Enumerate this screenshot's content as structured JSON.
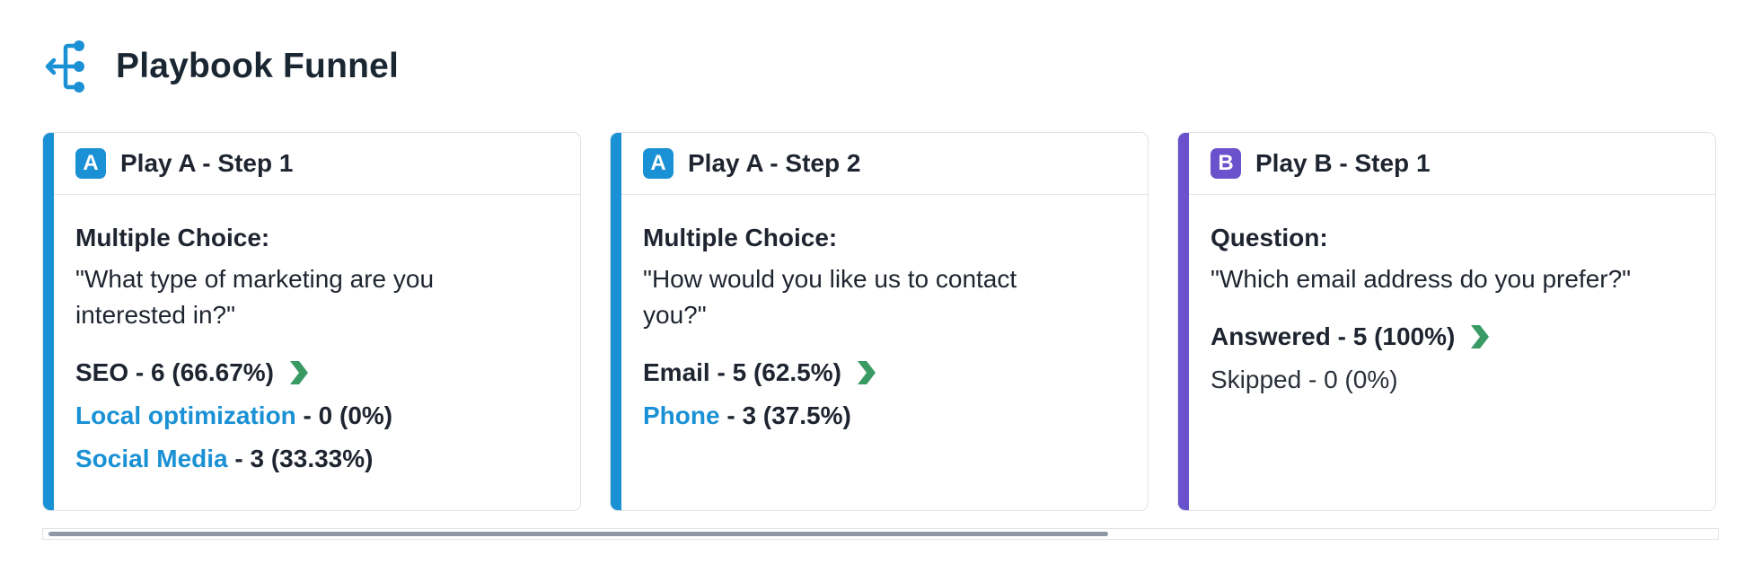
{
  "header": {
    "title": "Playbook Funnel",
    "icon": "funnel-flow-icon"
  },
  "colors": {
    "play_a": "#1a91d4",
    "play_b": "#6a52cc",
    "link": "#1a91d4",
    "arrow": "#3a9a64"
  },
  "cards": [
    {
      "badge": "A",
      "title": "Play A - Step 1",
      "question_type": "Multiple Choice:",
      "question_text": "\"What type of marketing are you interested in?\"",
      "answers": [
        {
          "option": "SEO",
          "stat": " - 6 (66.67%)",
          "link": false,
          "arrow": true
        },
        {
          "option": "Local optimization",
          "stat": " - 0 (0%)",
          "link": true,
          "arrow": false
        },
        {
          "option": "Social Media",
          "stat": " - 3 (33.33%)",
          "link": true,
          "arrow": false
        }
      ]
    },
    {
      "badge": "A",
      "title": "Play A - Step 2",
      "question_type": "Multiple Choice:",
      "question_text": "\"How would you like us to contact you?\"",
      "answers": [
        {
          "option": "Email",
          "stat": " - 5 (62.5%)",
          "link": false,
          "arrow": true
        },
        {
          "option": "Phone",
          "stat": " - 3 (37.5%)",
          "link": true,
          "arrow": false
        }
      ]
    },
    {
      "badge": "B",
      "title": "Play B - Step 1",
      "question_type": "Question:",
      "question_text": "\"Which email address do you prefer?\"",
      "answers": [
        {
          "option": "Answered",
          "stat": " - 5 (100%)",
          "link": false,
          "arrow": true
        },
        {
          "option": "Skipped",
          "stat": " - 0 (0%)",
          "link": false,
          "arrow": false,
          "plain": true
        }
      ]
    }
  ]
}
